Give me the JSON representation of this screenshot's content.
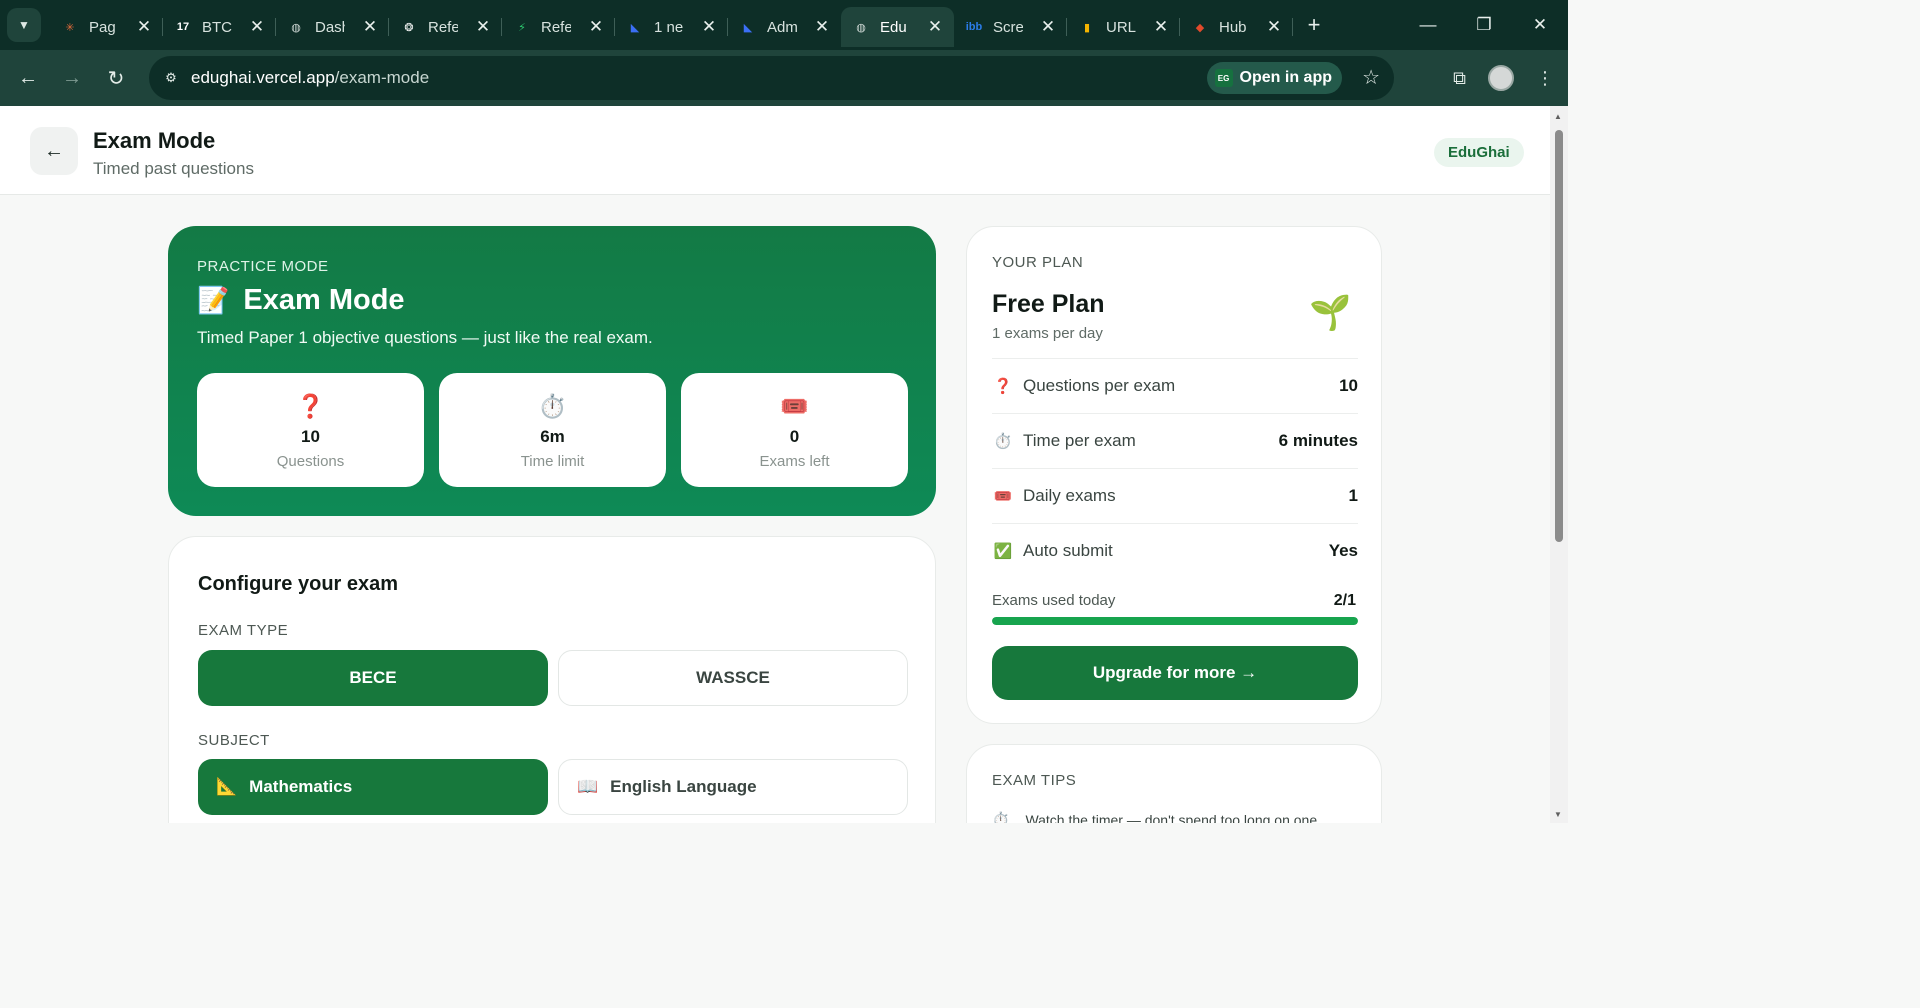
{
  "browser": {
    "tabs": [
      {
        "label": "Pag",
        "icon": "sunburst-icon",
        "color": "#e06a3b",
        "glyph": "✳"
      },
      {
        "label": "BTCU",
        "icon": "tradingview-icon",
        "color": "#ffffff",
        "glyph": "17"
      },
      {
        "label": "Dash",
        "icon": "globe-icon",
        "color": "#cfd8d5",
        "glyph": "◍"
      },
      {
        "label": "Refe",
        "icon": "openai-icon",
        "color": "#ffffff",
        "glyph": "❂"
      },
      {
        "label": "Refe",
        "icon": "bolt-icon",
        "color": "#2ecc71",
        "glyph": "⚡"
      },
      {
        "label": "1 ne",
        "icon": "chevron-logo-icon",
        "color": "#3b6ff5",
        "glyph": "◣"
      },
      {
        "label": "Adm",
        "icon": "chevron-logo-icon",
        "color": "#3b6ff5",
        "glyph": "◣"
      },
      {
        "label": "Edu",
        "icon": "globe-icon",
        "color": "#cfd8d5",
        "glyph": "◍",
        "active": true
      },
      {
        "label": "Scre",
        "icon": "ibb-icon",
        "color": "#2b7de9",
        "glyph": "ibb"
      },
      {
        "label": "URL",
        "icon": "analytics-icon",
        "color": "#f4b400",
        "glyph": "▮"
      },
      {
        "label": "Hub",
        "icon": "hub-icon",
        "color": "#e24a2b",
        "glyph": "◆"
      }
    ],
    "url_host": "edughai.vercel.app",
    "url_path": "/exam-mode",
    "open_in_app": "Open in app",
    "open_in_app_badge": "EG"
  },
  "header": {
    "back": "←",
    "title": "Exam Mode",
    "subtitle": "Timed past questions",
    "brand": "EduGhai"
  },
  "hero": {
    "kicker": "PRACTICE MODE",
    "emoji": "📝",
    "title": "Exam Mode",
    "description": "Timed Paper 1 objective questions — just like the real exam.",
    "stats": [
      {
        "icon": "question-icon",
        "glyph": "❓",
        "value": "10",
        "label": "Questions"
      },
      {
        "icon": "stopwatch-icon",
        "glyph": "⏱️",
        "value": "6m",
        "label": "Time limit"
      },
      {
        "icon": "ticket-icon",
        "glyph": "🎟️",
        "value": "0",
        "label": "Exams left"
      }
    ]
  },
  "config": {
    "title": "Configure your exam",
    "exam_type_label": "EXAM TYPE",
    "exam_types": [
      "BECE",
      "WASSCE"
    ],
    "selected_exam_type": "BECE",
    "subject_label": "SUBJECT",
    "subjects": [
      {
        "label": "Mathematics",
        "icon": "triangle-ruler-icon",
        "glyph": "📐"
      },
      {
        "label": "English Language",
        "icon": "book-icon",
        "glyph": "📖"
      }
    ],
    "selected_subject": "Mathematics"
  },
  "plan": {
    "kicker": "YOUR PLAN",
    "name": "Free Plan",
    "sub": "1 exams per day",
    "icon": "seedling-icon",
    "glyph": "🌱",
    "features": [
      {
        "icon": "question-icon",
        "glyph": "❓",
        "name": "Questions per exam",
        "value": "10"
      },
      {
        "icon": "stopwatch-icon",
        "glyph": "⏱️",
        "name": "Time per exam",
        "value": "6 minutes"
      },
      {
        "icon": "ticket-icon",
        "glyph": "🎟️",
        "name": "Daily exams",
        "value": "1"
      },
      {
        "icon": "checkbox-icon",
        "glyph": "✅",
        "name": "Auto submit",
        "value": "Yes"
      }
    ],
    "used_label": "Exams used today",
    "used_value": "2/1",
    "used_fraction": 1.0,
    "upgrade": "Upgrade for more →"
  },
  "tips": {
    "kicker": "EXAM TIPS",
    "items": [
      {
        "icon": "stopwatch-icon",
        "glyph": "⏱️",
        "text": "Watch the timer — don't spend too long on one"
      }
    ]
  },
  "colors": {
    "accent": "#17783c",
    "hero_gradient_start": "#137a45",
    "hero_gradient_end": "#0e8a56",
    "progress": "#17a44e",
    "chrome": "#0d2e27"
  }
}
